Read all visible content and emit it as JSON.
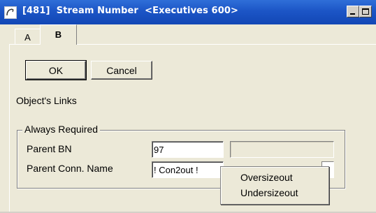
{
  "window": {
    "title": "[481]  Stream Number  <Executives 600>",
    "buttons": {
      "minimize": "minimize",
      "maximize": "maximize"
    }
  },
  "tabs": [
    {
      "label": "A",
      "active": false
    },
    {
      "label": "B",
      "active": true
    }
  ],
  "actions": {
    "ok_label": "OK",
    "cancel_label": "Cancel"
  },
  "section_label": "Object's Links",
  "group": {
    "title": "Always Required",
    "fields": [
      {
        "label": "Parent BN",
        "value": "97"
      },
      {
        "label": "Parent Conn. Name",
        "value": "! Con2out !"
      }
    ]
  },
  "dropdown": {
    "options": [
      "Oversizeout",
      "Undersizeout"
    ]
  },
  "colors": {
    "titlebar": "#1c55c6",
    "face": "#ece9d8"
  }
}
